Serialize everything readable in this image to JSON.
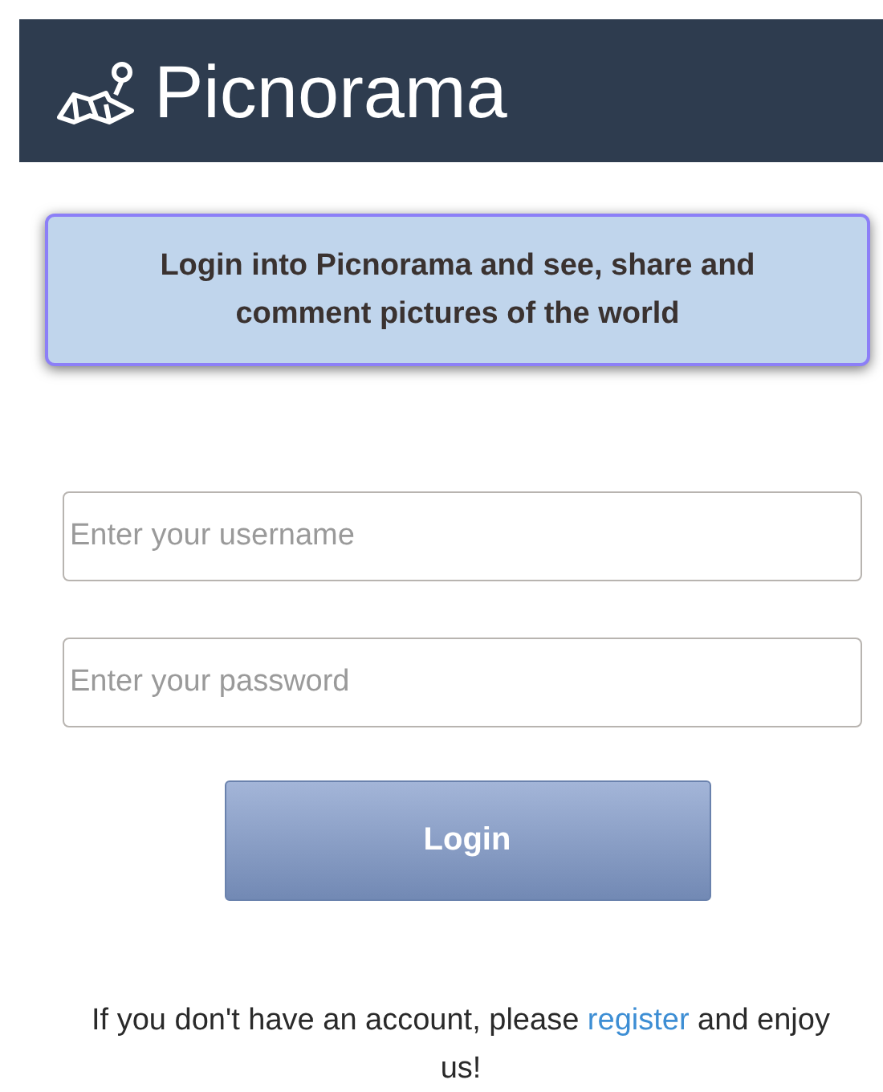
{
  "header": {
    "title": "Picnorama"
  },
  "banner": {
    "text": "Login into Picnorama and see, share and comment pictures of the world"
  },
  "fields": [
    {
      "placeholder": "Enter your username"
    },
    {
      "placeholder": "Enter your password"
    }
  ],
  "login_button": {
    "label": "Login"
  },
  "footer": {
    "before": "If you don't have an account, please ",
    "link": "register",
    "after": " and enjoy us!"
  }
}
